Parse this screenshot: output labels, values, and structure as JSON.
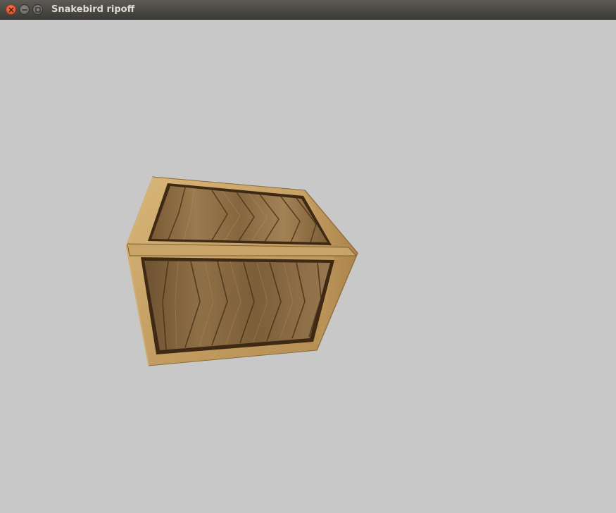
{
  "window": {
    "title": "Snakebird ripoff",
    "controls": {
      "close": "close-icon",
      "minimize": "minimize-icon",
      "maximize": "maximize-icon"
    }
  },
  "scene": {
    "background_color": "#c8c8c8",
    "objects": [
      {
        "type": "wooden-crate",
        "colors": {
          "frame": "#c9a468",
          "plank": "#8c6a3f",
          "shadow": "#3e2a14"
        }
      }
    ]
  }
}
